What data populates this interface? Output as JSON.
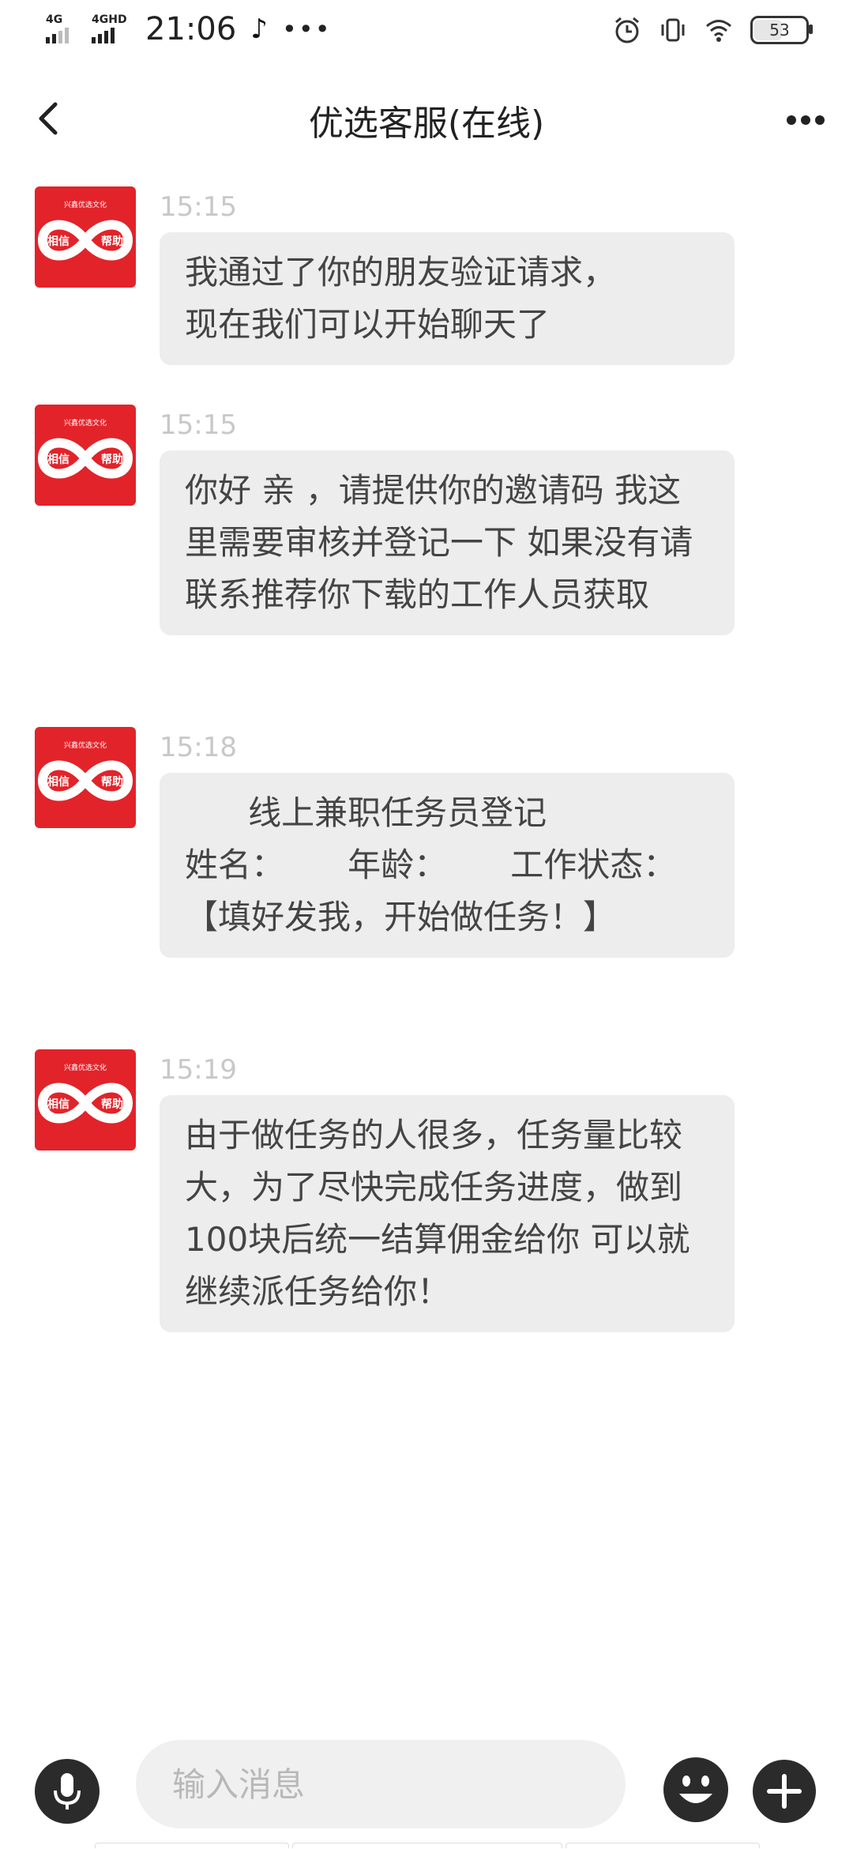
{
  "status_bar": {
    "signal1": "4G",
    "signal2": "4GHD",
    "time": "21:06",
    "battery": "53"
  },
  "header": {
    "title": "优选客服(在线)"
  },
  "messages": [
    {
      "time": "15:15",
      "text": "我通过了你的朋友验证请求，\n现在我们可以开始聊天了"
    },
    {
      "time": "15:15",
      "text": "你好 亲 ，请提供你的邀请码 我这里需要审核并登记一下 如果没有请联系推荐你下载的工作人员获取"
    },
    {
      "time": "15:18",
      "text": "      线上兼职任务员登记\n姓名：      年龄：      工作状态：\n【填好发我，开始做任务！】"
    },
    {
      "time": "15:19",
      "text": "由于做任务的人很多，任务量比较大，为了尽快完成任务进度，做到100块后统一结算佣金给你 可以就继续派任务给你！"
    }
  ],
  "avatar": {
    "top_text": "兴鑫优选文化",
    "left_text": "相信",
    "right_text": "帮助",
    "bg_color": "#e2232a"
  },
  "input": {
    "placeholder": "输入消息"
  }
}
